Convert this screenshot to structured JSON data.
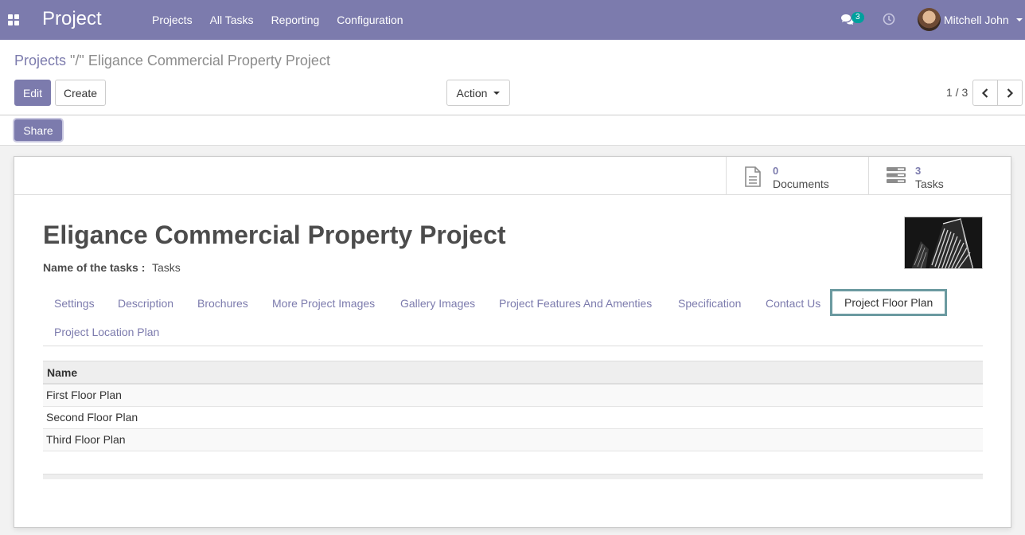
{
  "navbar": {
    "brand": "Project",
    "menu": [
      "Projects",
      "All Tasks",
      "Reporting",
      "Configuration"
    ],
    "chat_count": "3",
    "user_name": "Mitchell John",
    "color": "#7c7bad"
  },
  "breadcrumb": {
    "parent": "Projects",
    "separator": " \"/\" ",
    "current": "Eligance Commercial Property Project"
  },
  "buttons": {
    "edit": "Edit",
    "create": "Create",
    "action": "Action",
    "share": "Share"
  },
  "pager": {
    "value": "1 / 3"
  },
  "stat_buttons": {
    "documents": {
      "value": "0",
      "label": "Documents",
      "icon": "document-icon"
    },
    "tasks": {
      "value": "3",
      "label": "Tasks",
      "icon": "tasks-icon"
    }
  },
  "record": {
    "title": "Eligance Commercial Property Project",
    "field_label": "Name of the tasks :",
    "field_value": "Tasks"
  },
  "tabs": [
    "Settings",
    "Description",
    "Brochures",
    "More Project Images",
    "Gallery Images",
    "Project Features And Amenties",
    "Specification",
    "Contact Us",
    "Project Floor Plan",
    "Project Location Plan"
  ],
  "active_tab": "Project Floor Plan",
  "table": {
    "header": "Name",
    "rows": [
      "First Floor Plan",
      "Second Floor Plan",
      "Third Floor Plan"
    ]
  }
}
